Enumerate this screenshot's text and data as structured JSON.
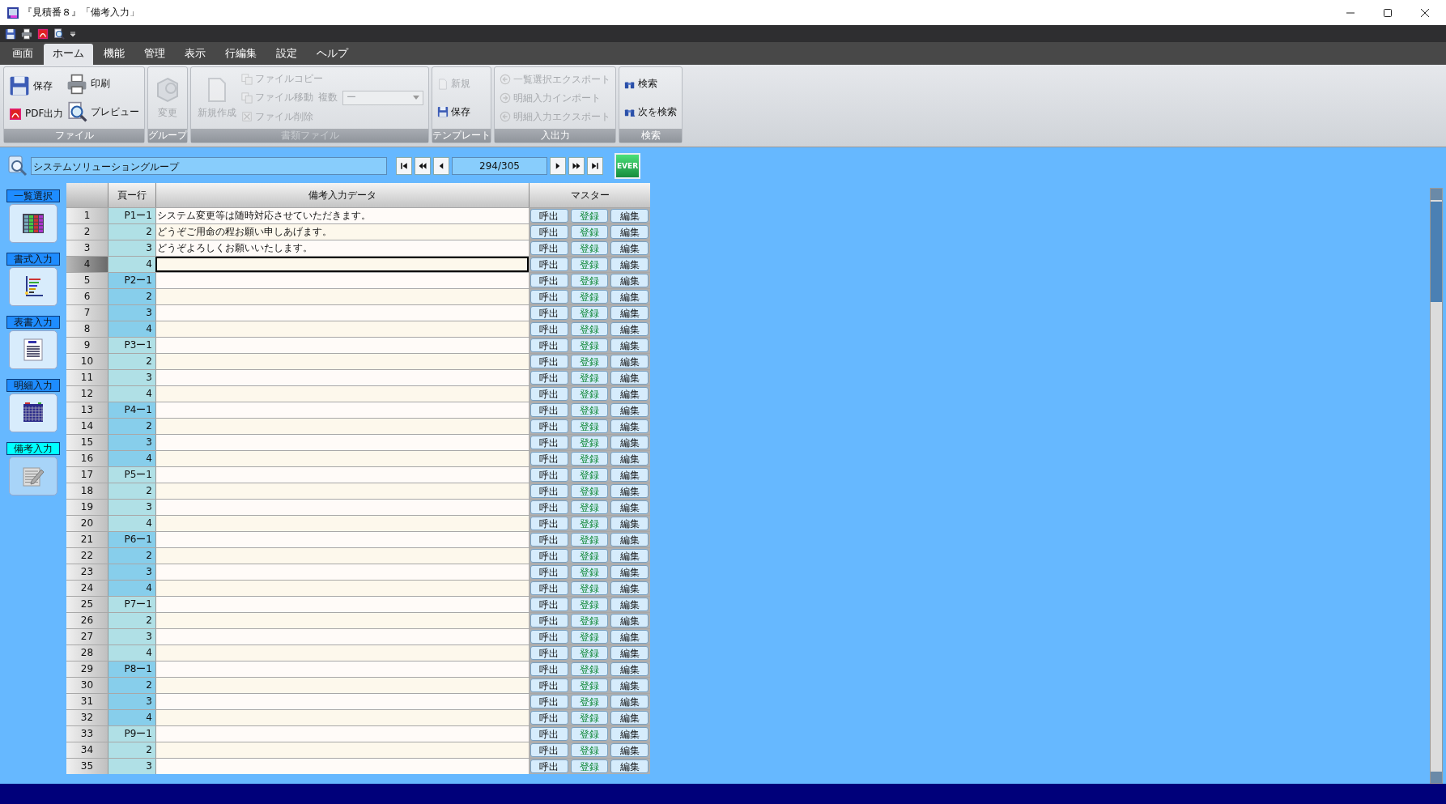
{
  "window": {
    "title": "『見積番８』「備考入力」"
  },
  "menu_tabs": [
    {
      "label": "画面",
      "selected": false
    },
    {
      "label": "ホーム",
      "selected": true
    },
    {
      "label": "機能",
      "selected": false
    },
    {
      "label": "管理",
      "selected": false
    },
    {
      "label": "表示",
      "selected": false
    },
    {
      "label": "行編集",
      "selected": false
    },
    {
      "label": "設定",
      "selected": false
    },
    {
      "label": "ヘルプ",
      "selected": false
    }
  ],
  "ribbon": {
    "groups": [
      {
        "label": "ファイル",
        "disabled": false,
        "columns": [
          [
            {
              "kind": "medium",
              "label": "保存",
              "disabled": false
            },
            {
              "kind": "medium",
              "label": "PDF出力",
              "disabled": false
            }
          ],
          [
            {
              "kind": "medium",
              "label": "印刷",
              "disabled": false
            },
            {
              "kind": "medium",
              "label": "プレビュー",
              "disabled": false
            }
          ]
        ]
      },
      {
        "label": "グループ",
        "disabled": false,
        "columns": [
          [
            {
              "kind": "big",
              "label": "変更",
              "disabled": true
            }
          ]
        ]
      },
      {
        "label": "書類ファイル",
        "disabled": true,
        "columns": [
          [
            {
              "kind": "big",
              "label": "新規作成",
              "disabled": true
            }
          ],
          [
            {
              "kind": "small",
              "label": "ファイルコピー",
              "disabled": true
            },
            {
              "kind": "small",
              "label": "ファイル移動",
              "disabled": true,
              "combo": {
                "label": "複数",
                "value": "ー",
                "disabled": true
              }
            },
            {
              "kind": "small",
              "label": "ファイル削除",
              "disabled": true
            }
          ]
        ]
      },
      {
        "label": "テンプレート",
        "disabled": false,
        "columns": [
          [
            {
              "kind": "small",
              "label": "新規",
              "disabled": true
            },
            {
              "kind": "small",
              "label": "保存",
              "disabled": false
            }
          ]
        ]
      },
      {
        "label": "入出力",
        "disabled": false,
        "columns": [
          [
            {
              "kind": "small",
              "label": "一覧選択エクスポート",
              "disabled": true
            },
            {
              "kind": "small",
              "label": "明細入力インポート",
              "disabled": true
            },
            {
              "kind": "small",
              "label": "明細入力エクスポート",
              "disabled": true
            }
          ]
        ]
      },
      {
        "label": "検索",
        "disabled": false,
        "columns": [
          [
            {
              "kind": "small",
              "label": "検索",
              "disabled": false
            },
            {
              "kind": "small",
              "label": "次を検索",
              "disabled": false
            }
          ]
        ]
      }
    ]
  },
  "toolbar": {
    "group_field": "システムソリューショングループ",
    "counter": "294/305",
    "ever_label": "EVER"
  },
  "sidebar": {
    "items": [
      {
        "label": "一覧選択",
        "selected": false
      },
      {
        "label": "書式入力",
        "selected": false
      },
      {
        "label": "表書入力",
        "selected": false
      },
      {
        "label": "明細入力",
        "selected": false
      },
      {
        "label": "備考入力",
        "selected": true
      }
    ]
  },
  "table": {
    "columns": [
      "頁ー行",
      "備考入力データ",
      "マスター"
    ],
    "rows": [
      {
        "no": "1",
        "page_row": "P1ー1",
        "color": "#b0e0e6",
        "note": "システム変更等は随時対応させていただきます。",
        "selected": false,
        "buttons": [
          "呼出",
          "登録",
          "編集"
        ]
      },
      {
        "no": "2",
        "page_row": "2",
        "color": "#b0e0e6",
        "note": "どうぞご用命の程お願い申しあげます。",
        "selected": false,
        "buttons": [
          "呼出",
          "登録",
          "編集"
        ]
      },
      {
        "no": "3",
        "page_row": "3",
        "color": "#b0e0e6",
        "note": "どうぞよろしくお願いいたします。",
        "selected": false,
        "buttons": [
          "呼出",
          "登録",
          "編集"
        ]
      },
      {
        "no": "4",
        "page_row": "4",
        "color": "#b0e0e6",
        "note": "",
        "selected": true,
        "buttons": [
          "呼出",
          "登録",
          "編集"
        ]
      },
      {
        "no": "5",
        "page_row": "P2ー1",
        "color": "#87ceeb",
        "note": "",
        "selected": false,
        "buttons": [
          "呼出",
          "登録",
          "編集"
        ]
      },
      {
        "no": "6",
        "page_row": "2",
        "color": "#87ceeb",
        "note": "",
        "selected": false,
        "buttons": [
          "呼出",
          "登録",
          "編集"
        ]
      },
      {
        "no": "7",
        "page_row": "3",
        "color": "#87ceeb",
        "note": "",
        "selected": false,
        "buttons": [
          "呼出",
          "登録",
          "編集"
        ]
      },
      {
        "no": "8",
        "page_row": "4",
        "color": "#87ceeb",
        "note": "",
        "selected": false,
        "buttons": [
          "呼出",
          "登録",
          "編集"
        ]
      },
      {
        "no": "9",
        "page_row": "P3ー1",
        "color": "#b0e0e6",
        "note": "",
        "selected": false,
        "buttons": [
          "呼出",
          "登録",
          "編集"
        ]
      },
      {
        "no": "10",
        "page_row": "2",
        "color": "#b0e0e6",
        "note": "",
        "selected": false,
        "buttons": [
          "呼出",
          "登録",
          "編集"
        ]
      },
      {
        "no": "11",
        "page_row": "3",
        "color": "#b0e0e6",
        "note": "",
        "selected": false,
        "buttons": [
          "呼出",
          "登録",
          "編集"
        ]
      },
      {
        "no": "12",
        "page_row": "4",
        "color": "#b0e0e6",
        "note": "",
        "selected": false,
        "buttons": [
          "呼出",
          "登録",
          "編集"
        ]
      },
      {
        "no": "13",
        "page_row": "P4ー1",
        "color": "#87ceeb",
        "note": "",
        "selected": false,
        "buttons": [
          "呼出",
          "登録",
          "編集"
        ]
      },
      {
        "no": "14",
        "page_row": "2",
        "color": "#87ceeb",
        "note": "",
        "selected": false,
        "buttons": [
          "呼出",
          "登録",
          "編集"
        ]
      },
      {
        "no": "15",
        "page_row": "3",
        "color": "#87ceeb",
        "note": "",
        "selected": false,
        "buttons": [
          "呼出",
          "登録",
          "編集"
        ]
      },
      {
        "no": "16",
        "page_row": "4",
        "color": "#87ceeb",
        "note": "",
        "selected": false,
        "buttons": [
          "呼出",
          "登録",
          "編集"
        ]
      },
      {
        "no": "17",
        "page_row": "P5ー1",
        "color": "#b0e0e6",
        "note": "",
        "selected": false,
        "buttons": [
          "呼出",
          "登録",
          "編集"
        ]
      },
      {
        "no": "18",
        "page_row": "2",
        "color": "#b0e0e6",
        "note": "",
        "selected": false,
        "buttons": [
          "呼出",
          "登録",
          "編集"
        ]
      },
      {
        "no": "19",
        "page_row": "3",
        "color": "#b0e0e6",
        "note": "",
        "selected": false,
        "buttons": [
          "呼出",
          "登録",
          "編集"
        ]
      },
      {
        "no": "20",
        "page_row": "4",
        "color": "#b0e0e6",
        "note": "",
        "selected": false,
        "buttons": [
          "呼出",
          "登録",
          "編集"
        ]
      },
      {
        "no": "21",
        "page_row": "P6ー1",
        "color": "#87ceeb",
        "note": "",
        "selected": false,
        "buttons": [
          "呼出",
          "登録",
          "編集"
        ]
      },
      {
        "no": "22",
        "page_row": "2",
        "color": "#87ceeb",
        "note": "",
        "selected": false,
        "buttons": [
          "呼出",
          "登録",
          "編集"
        ]
      },
      {
        "no": "23",
        "page_row": "3",
        "color": "#87ceeb",
        "note": "",
        "selected": false,
        "buttons": [
          "呼出",
          "登録",
          "編集"
        ]
      },
      {
        "no": "24",
        "page_row": "4",
        "color": "#87ceeb",
        "note": "",
        "selected": false,
        "buttons": [
          "呼出",
          "登録",
          "編集"
        ]
      },
      {
        "no": "25",
        "page_row": "P7ー1",
        "color": "#b0e0e6",
        "note": "",
        "selected": false,
        "buttons": [
          "呼出",
          "登録",
          "編集"
        ]
      },
      {
        "no": "26",
        "page_row": "2",
        "color": "#b0e0e6",
        "note": "",
        "selected": false,
        "buttons": [
          "呼出",
          "登録",
          "編集"
        ]
      },
      {
        "no": "27",
        "page_row": "3",
        "color": "#b0e0e6",
        "note": "",
        "selected": false,
        "buttons": [
          "呼出",
          "登録",
          "編集"
        ]
      },
      {
        "no": "28",
        "page_row": "4",
        "color": "#b0e0e6",
        "note": "",
        "selected": false,
        "buttons": [
          "呼出",
          "登録",
          "編集"
        ]
      },
      {
        "no": "29",
        "page_row": "P8ー1",
        "color": "#87ceeb",
        "note": "",
        "selected": false,
        "buttons": [
          "呼出",
          "登録",
          "編集"
        ]
      },
      {
        "no": "30",
        "page_row": "2",
        "color": "#87ceeb",
        "note": "",
        "selected": false,
        "buttons": [
          "呼出",
          "登録",
          "編集"
        ]
      },
      {
        "no": "31",
        "page_row": "3",
        "color": "#87ceeb",
        "note": "",
        "selected": false,
        "buttons": [
          "呼出",
          "登録",
          "編集"
        ]
      },
      {
        "no": "32",
        "page_row": "4",
        "color": "#87ceeb",
        "note": "",
        "selected": false,
        "buttons": [
          "呼出",
          "登録",
          "編集"
        ]
      },
      {
        "no": "33",
        "page_row": "P9ー1",
        "color": "#b0e0e6",
        "note": "",
        "selected": false,
        "buttons": [
          "呼出",
          "登録",
          "編集"
        ]
      },
      {
        "no": "34",
        "page_row": "2",
        "color": "#b0e0e6",
        "note": "",
        "selected": false,
        "buttons": [
          "呼出",
          "登録",
          "編集"
        ]
      },
      {
        "no": "35",
        "page_row": "3",
        "color": "#b0e0e6",
        "note": "",
        "selected": false,
        "buttons": [
          "呼出",
          "登録",
          "編集"
        ]
      }
    ]
  }
}
